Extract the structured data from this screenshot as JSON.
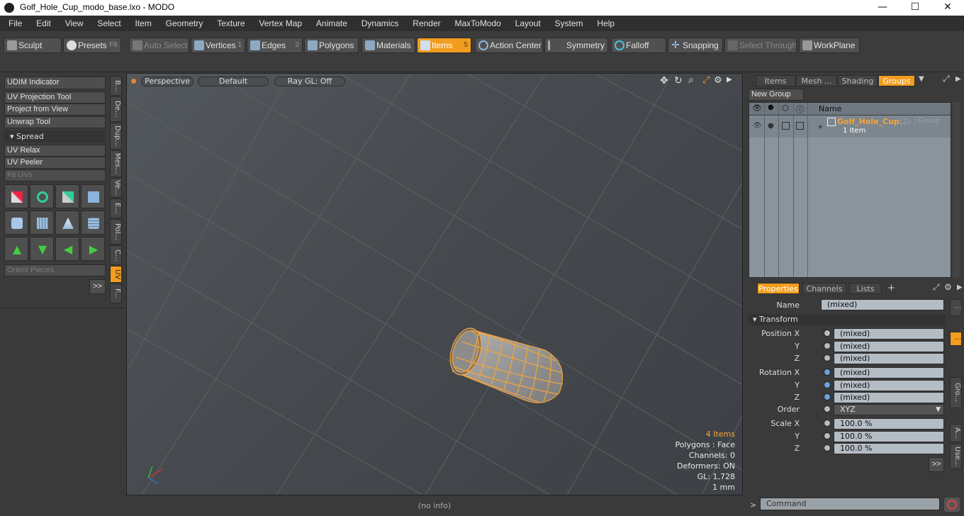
{
  "window": {
    "title": "Golf_Hole_Cup_modo_base.lxo - MODO",
    "minimize": "—",
    "maximize": "☐",
    "close": "✕"
  },
  "menu": [
    "File",
    "Edit",
    "View",
    "Select",
    "Item",
    "Geometry",
    "Texture",
    "Vertex Map",
    "Animate",
    "Dynamics",
    "Render",
    "MaxToModo",
    "Layout",
    "System",
    "Help"
  ],
  "toolbar": {
    "sculpt": "Sculpt",
    "presets": "Presets",
    "presets_key": "F6",
    "auto_select": "Auto Select",
    "vertices": "Vertices",
    "vertices_num": "1",
    "edges": "Edges",
    "edges_num": "2",
    "polygons": "Polygons",
    "materials": "Materials",
    "items": "Items",
    "items_num": "5",
    "action_center": "Action Center",
    "symmetry": "Symmetry",
    "falloff": "Falloff",
    "snapping": "Snapping",
    "select_through": "Select Through",
    "workplane": "WorkPlane"
  },
  "left": {
    "udim": "UDIM Indicator",
    "uv_projection": "UV Projection Tool",
    "project_view": "Project from View",
    "unwrap": "Unwrap Tool",
    "spread": "Spread",
    "uv_relax": "UV Relax",
    "uv_peeler": "UV Peeler",
    "fit_uvs": "Fit UVs",
    "orient": "Orient Pieces",
    "more": ">>",
    "vtabs": [
      "B...",
      "De...",
      "Dup...",
      "Mes...",
      "Ve...",
      "E...",
      "Pol...",
      "C...",
      "UV",
      "F..."
    ]
  },
  "viewport": {
    "perspective": "Perspective",
    "default": "Default",
    "raygl": "Ray GL: Off",
    "info": {
      "items": "4 Items",
      "polygons": "Polygons : Face",
      "channels": "Channels: 0",
      "deformers": "Deformers: ON",
      "gl": "GL: 1,728",
      "unit": "1 mm"
    },
    "status": "(no info)"
  },
  "right": {
    "tabs": [
      "Items",
      "Mesh ...",
      "Shading",
      "Groups"
    ],
    "new_group": "New Group",
    "col_name": "Name",
    "group_name": "Golf_Hole_Cup",
    "group_count": "(2)",
    "group_type": ": Group",
    "group_sub": "1 Item",
    "prop_tabs": [
      "Properties",
      "Channels",
      "Lists"
    ],
    "plus": "+",
    "name_label": "Name",
    "name_value": "(mixed)",
    "transform": "Transform",
    "pos_x": "Position X",
    "rot_x": "Rotation X",
    "scale_x": "Scale X",
    "y": "Y",
    "z": "Z",
    "mixed": "(mixed)",
    "order_label": "Order",
    "order_value": "XYZ",
    "scale_value": "100.0 %",
    "side_tabs": [
      "Gro...",
      "A...",
      "Use..."
    ],
    "more": ">>",
    "command_prompt": ">",
    "command": "Command"
  },
  "colors": {
    "accent": "#f29d1f",
    "mesh": "#f5a43a"
  }
}
